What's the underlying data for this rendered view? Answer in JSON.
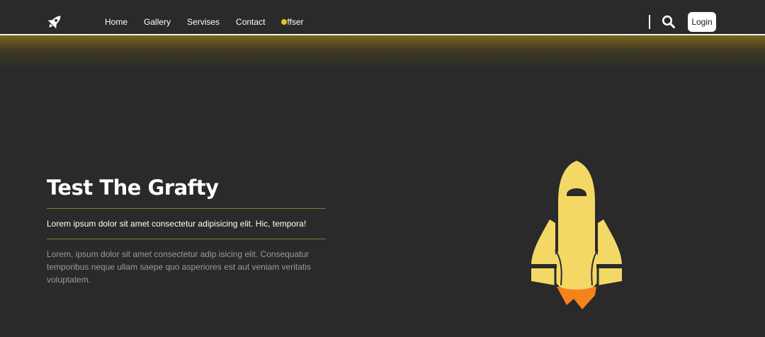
{
  "nav": {
    "links": [
      "Home",
      "Gallery",
      "Servises",
      "Contact"
    ],
    "offer_label": "ffser",
    "login_label": "Login"
  },
  "hero": {
    "title": "Test The Grafty",
    "lead": "Lorem ipsum dolor sit amet consectetur adipisicing elit. Hic, tempora!",
    "body": "Lorem, ipsum dolor sit amet consectetur adip isicing elit. Consequatur temporibus neque ullam saepe quo asperiores est aut veniam veritatis voluptatem."
  },
  "icons": {
    "logo": "rocket-icon",
    "search": "search-icon",
    "hero_image": "rocket-illustration"
  },
  "colors": {
    "background": "#2a2a2a",
    "accent_yellow": "#f4d866",
    "flame_orange": "#f5821f",
    "offer_dot": "#e8c21d"
  }
}
